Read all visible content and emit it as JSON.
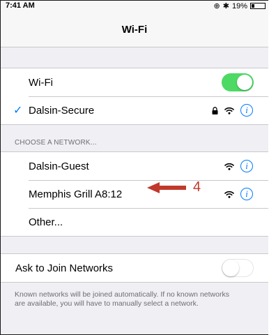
{
  "status": {
    "time": "7:41 AM",
    "battery": "19%",
    "battery_level": 0.19
  },
  "nav": {
    "title": "Wi-Fi"
  },
  "wifi_group": {
    "wifi_label": "Wi-Fi",
    "wifi_on": true,
    "connected_network": "Dalsin-Secure"
  },
  "choose_header": "CHOOSE A NETWORK...",
  "networks": [
    {
      "name": "Dalsin-Guest"
    },
    {
      "name": "Memphis Grill A8:12"
    },
    {
      "name": "Other..."
    }
  ],
  "annotation": {
    "text": "4",
    "color": "#c0392b"
  },
  "ask_group": {
    "label": "Ask to Join Networks",
    "on": false
  },
  "footer": "Known networks will be joined automatically. If no known networks are available, you will have to manually select a network.",
  "colors": {
    "accent": "#007aff",
    "toggle_on": "#4cd964",
    "background": "#efeff4"
  },
  "icons": [
    "wifi-icon",
    "lock-icon",
    "info-icon",
    "checkmark-icon",
    "bluetooth-icon",
    "battery-icon",
    "rotation-lock-icon"
  ]
}
